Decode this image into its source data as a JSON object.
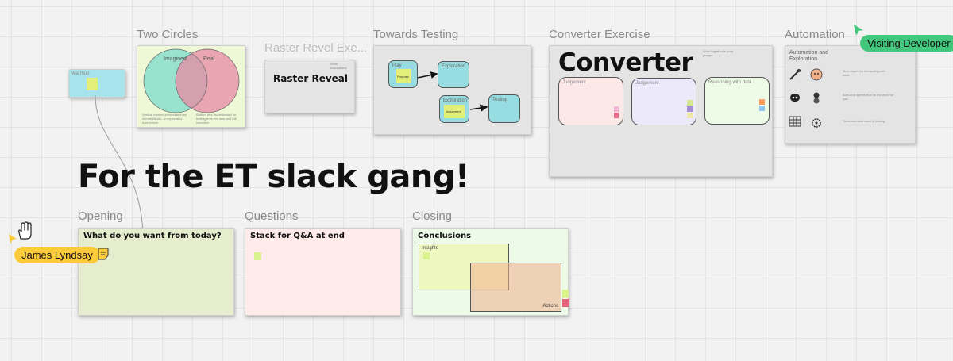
{
  "board": {
    "headline": "For the ET slack gang!"
  },
  "frames": {
    "warmup": {
      "label": "Warmup"
    },
    "two_circles": {
      "title": "Two Circles",
      "left_label": "Imagined",
      "right_label": "Real",
      "left_caption": "Vertical marked presentation by mental bitrate, or expectation from before",
      "right_caption": "Bottom of a fist-whirlwind for testing from the data and the recorded"
    },
    "raster_reveal": {
      "title": "Raster Revel Exe...",
      "heading": "Raster Reveal",
      "note": "Work Instructions"
    },
    "towards_testing": {
      "title": "Towards Testing",
      "box_play": "Play",
      "box_exploration_top": "Exploration",
      "box_exploration": "Exploration",
      "box_testing": "Testing",
      "sticky_a": "Purpose",
      "sticky_b": "Judgement"
    },
    "converter": {
      "title": "Converter Exercise",
      "heading": "Converter",
      "note": "Work together in your groups",
      "area_1": "Judgement",
      "area_2": "Judgement",
      "area_3": "Reasoning with data"
    },
    "automation": {
      "title": "Automation",
      "heading": "Automation and Exploration",
      "row1_text": "Techniques for interacting with code",
      "row2_text": "Bots and agents that do the work for you",
      "row3_text": "Tools and data used in testing"
    },
    "opening": {
      "title": "Opening",
      "heading": "What do you want from today?"
    },
    "questions": {
      "title": "Questions",
      "heading": "Stack for Q&A at end"
    },
    "closing": {
      "title": "Closing",
      "heading": "Conclusions",
      "box_insights": "Insights",
      "box_actions": "Actions"
    }
  },
  "cursors": {
    "visiting": {
      "name": "Visiting Developer",
      "color": "#42c87d"
    },
    "james": {
      "name": "James Lyndsay",
      "color": "#fccb3a"
    }
  },
  "icons": {
    "hand": "hand-cursor-icon",
    "sticky": "sticky-note-icon"
  }
}
